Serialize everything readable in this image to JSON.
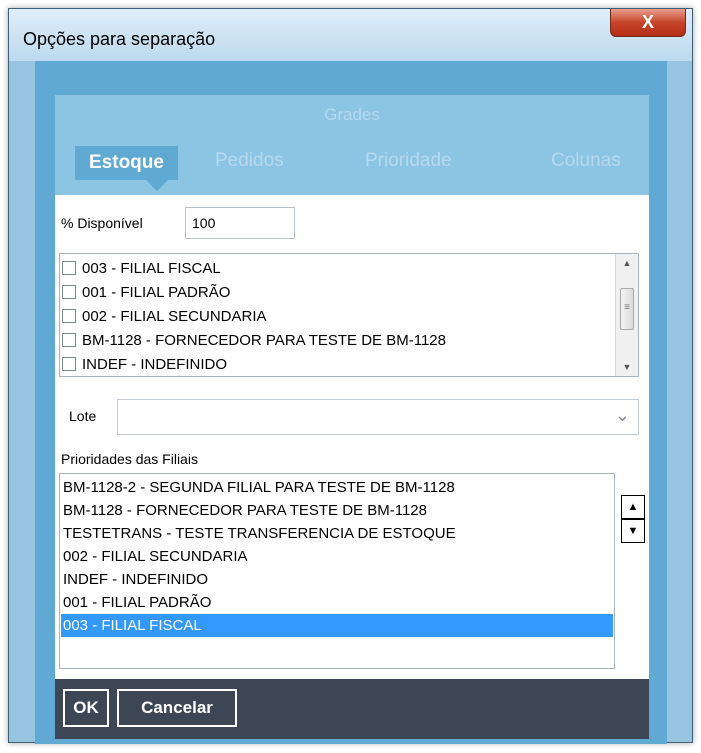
{
  "window": {
    "title": "Opções para separação",
    "close_label": "X"
  },
  "tabs": {
    "header": "Grades",
    "items": [
      {
        "label": "Estoque",
        "active": true
      },
      {
        "label": "Pedidos",
        "active": false
      },
      {
        "label": "Prioridade",
        "active": false
      },
      {
        "label": "Colunas",
        "active": false
      }
    ]
  },
  "estoque": {
    "disponivel_label": "% Disponível",
    "disponivel_value": "100",
    "filiais": [
      {
        "label": "003 - FILIAL FISCAL",
        "checked": false
      },
      {
        "label": "001 - FILIAL PADRÃO",
        "checked": false
      },
      {
        "label": "002 - FILIAL SECUNDARIA",
        "checked": false
      },
      {
        "label": "BM-1128 - FORNECEDOR PARA TESTE DE BM-1128",
        "checked": false
      },
      {
        "label": "INDEF - INDEFINIDO",
        "checked": false
      }
    ],
    "lote_label": "Lote",
    "lote_value": "",
    "prioridades_label": "Prioridades das Filiais",
    "prioridades": [
      {
        "label": "BM-1128-2 - SEGUNDA FILIAL PARA TESTE DE BM-1128",
        "selected": false
      },
      {
        "label": "BM-1128 - FORNECEDOR PARA TESTE DE BM-1128",
        "selected": false
      },
      {
        "label": "TESTETRANS - TESTE TRANSFERENCIA DE ESTOQUE",
        "selected": false
      },
      {
        "label": "002 - FILIAL SECUNDARIA",
        "selected": false
      },
      {
        "label": "INDEF - INDEFINIDO",
        "selected": false
      },
      {
        "label": "001 - FILIAL PADRÃO",
        "selected": false
      },
      {
        "label": "003 - FILIAL FISCAL",
        "selected": true
      }
    ]
  },
  "footer": {
    "ok_label": "OK",
    "cancel_label": "Cancelar"
  },
  "icons": {
    "scroll_up": "triangle-up-icon",
    "scroll_down": "triangle-down-icon",
    "combo": "chevron-down-icon",
    "move_up": "arrow-up-icon",
    "move_down": "arrow-down-icon"
  },
  "colors": {
    "window_frame": "#97c4e0",
    "tab_active": "#5fa9d2",
    "selection": "#3399ff",
    "footer": "#3c4654"
  }
}
